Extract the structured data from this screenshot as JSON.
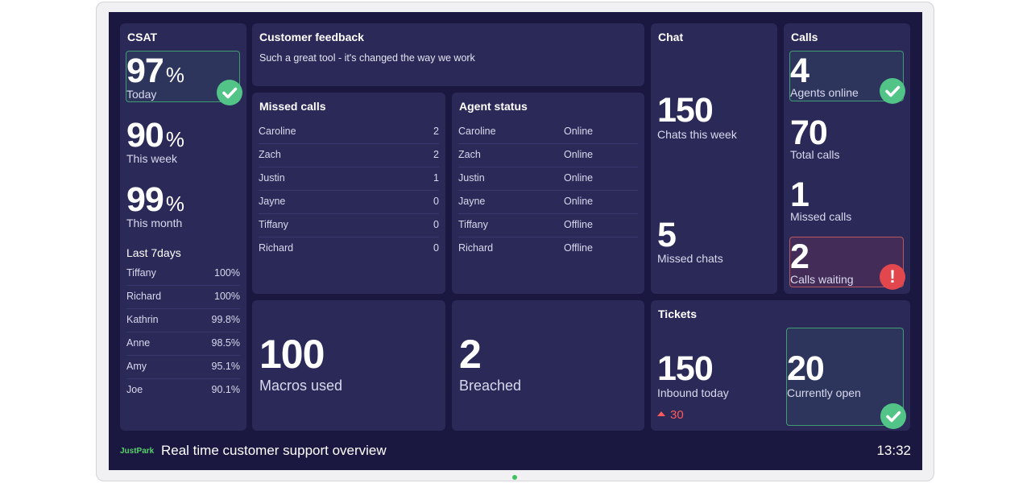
{
  "colors": {
    "background": "#1a1840",
    "panel": "#2a2958",
    "good": "#52c487",
    "alert": "#e1474d",
    "logo": "#56d36b"
  },
  "csat": {
    "title": "CSAT",
    "today": {
      "value": "97",
      "unit": "%",
      "label": "Today",
      "status_icon": "check-icon"
    },
    "week": {
      "value": "90",
      "unit": "%",
      "label": "This week"
    },
    "month": {
      "value": "99",
      "unit": "%",
      "label": "This month"
    },
    "last7_title": "Last 7days",
    "agents": [
      {
        "name": "Tiffany",
        "value": "100%"
      },
      {
        "name": "Richard",
        "value": "100%"
      },
      {
        "name": "Kathrin",
        "value": "99.8%"
      },
      {
        "name": "Anne",
        "value": "98.5%"
      },
      {
        "name": "Amy",
        "value": "95.1%"
      },
      {
        "name": "Joe",
        "value": "90.1%"
      }
    ]
  },
  "feedback": {
    "title": "Customer feedback",
    "text": "Such a great tool - it's changed the way we work"
  },
  "missed_calls": {
    "title": "Missed calls",
    "rows": [
      {
        "name": "Caroline",
        "count": "2"
      },
      {
        "name": "Zach",
        "count": "2"
      },
      {
        "name": "Justin",
        "count": "1"
      },
      {
        "name": "Jayne",
        "count": "0"
      },
      {
        "name": "Tiffany",
        "count": "0"
      },
      {
        "name": "Richard",
        "count": "0"
      }
    ]
  },
  "agent_status": {
    "title": "Agent status",
    "rows": [
      {
        "name": "Caroline",
        "status": "Online"
      },
      {
        "name": "Zach",
        "status": "Online"
      },
      {
        "name": "Justin",
        "status": "Online"
      },
      {
        "name": "Jayne",
        "status": "Online"
      },
      {
        "name": "Tiffany",
        "status": "Offline"
      },
      {
        "name": "Richard",
        "status": "Offline"
      }
    ]
  },
  "chat": {
    "title": "Chat",
    "week": {
      "value": "150",
      "label": "Chats this week"
    },
    "missed": {
      "value": "5",
      "label": "Missed chats"
    }
  },
  "calls": {
    "title": "Calls",
    "agents_online": {
      "value": "4",
      "label": "Agents online",
      "status_icon": "check-icon"
    },
    "total": {
      "value": "70",
      "label": "Total calls"
    },
    "missed": {
      "value": "1",
      "label": "Missed calls"
    },
    "waiting": {
      "value": "2",
      "label": "Calls waiting",
      "status_icon": "alert-icon"
    }
  },
  "macros": {
    "value": "100",
    "label": "Macros used"
  },
  "breached": {
    "value": "2",
    "label": "Breached"
  },
  "tickets": {
    "title": "Tickets",
    "inbound": {
      "value": "150",
      "label": "Inbound today",
      "delta": "30",
      "delta_icon": "arrow-up-icon"
    },
    "open": {
      "value": "20",
      "label": "Currently open",
      "status_icon": "check-icon"
    }
  },
  "footer": {
    "logo": "JustPark",
    "title": "Real time customer support overview",
    "time": "13:32"
  }
}
